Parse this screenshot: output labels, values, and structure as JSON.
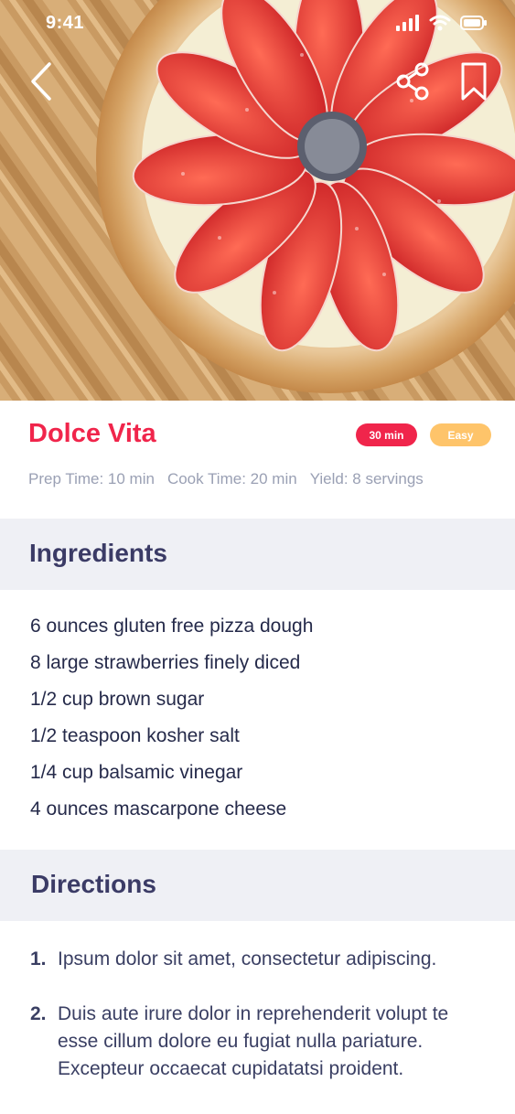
{
  "status_bar": {
    "time": "9:41"
  },
  "navigation": {
    "back_icon": "chevron-left-icon",
    "share_icon": "share-icon",
    "bookmark_icon": "bookmark-icon"
  },
  "recipe": {
    "title": "Dolce Vita",
    "badges": {
      "time": "30 min",
      "level": "Easy"
    },
    "meta": {
      "prep_time": "Prep Time: 10 min",
      "cook_time": "Cook Time: 20 min",
      "yield": "Yield: 8 servings"
    }
  },
  "ingredients": {
    "title": "Ingredients",
    "items": [
      "6 ounces gluten free pizza dough",
      "8 large strawberries finely diced",
      "1/2 cup brown sugar",
      "1/2 teaspoon kosher salt",
      "1/4 cup balsamic vinegar",
      "4 ounces mascarpone cheese"
    ]
  },
  "directions": {
    "title": "Directions",
    "steps": [
      {
        "num": "1.",
        "text": "Ipsum dolor sit amet, consectetur adipiscing."
      },
      {
        "num": "2.",
        "text": "Duis aute irure dolor in reprehenderit volupt te esse cillum dolore eu fugiat nulla pariature. Excepteur occaecat cupidatatsi proident."
      }
    ]
  },
  "colors": {
    "accent": "#f0254b",
    "badge_easy": "#fec46a",
    "heading": "#3b3b66",
    "section_bg": "#eff0f5",
    "meta_text": "#9aa0b4"
  }
}
